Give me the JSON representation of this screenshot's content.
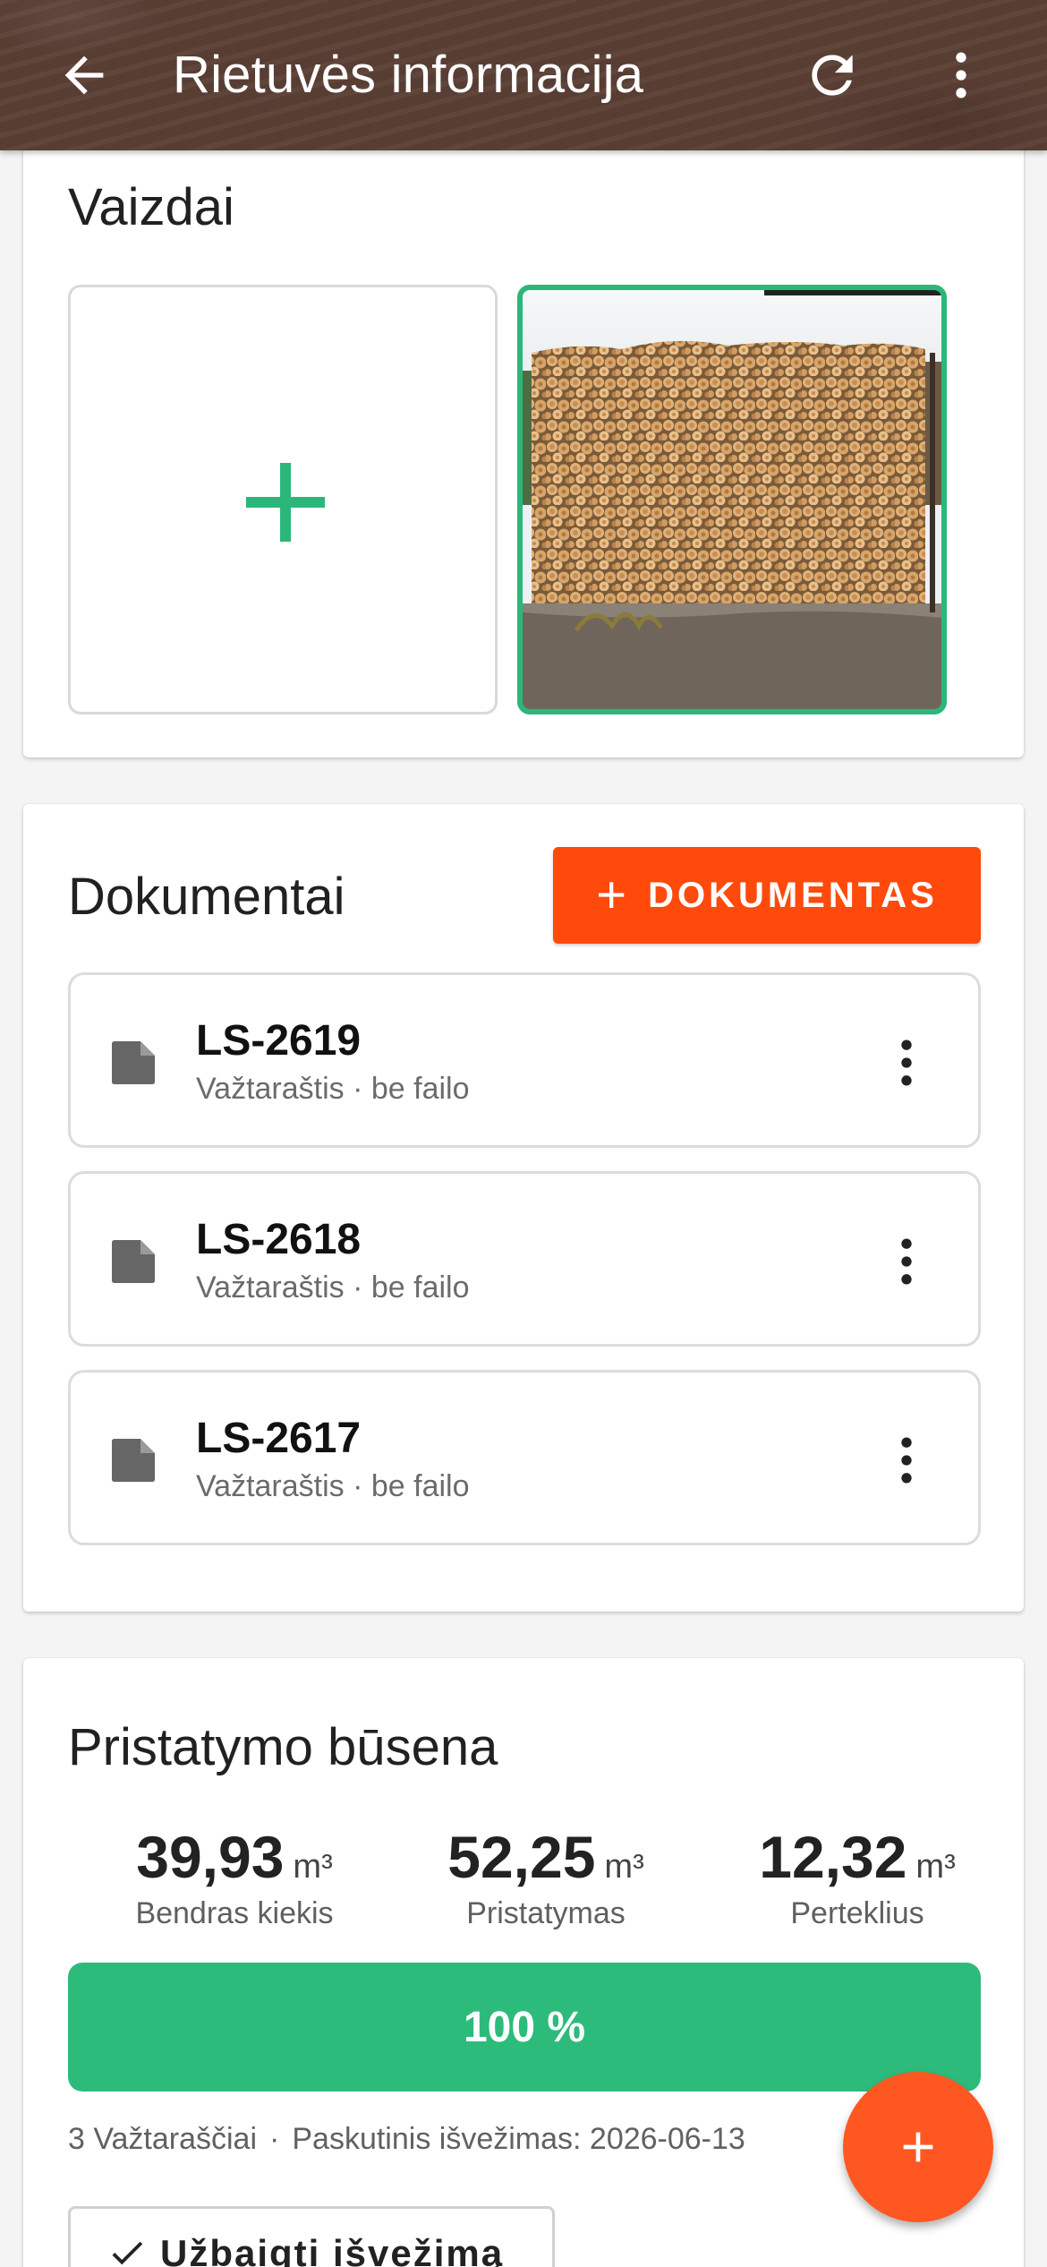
{
  "appbar": {
    "title": "Rietuvės informacija",
    "icons": [
      "arrow-back-icon",
      "refresh-icon",
      "more-vert-icon"
    ]
  },
  "images_section": {
    "title": "Vaizdai",
    "add_icon": "plus-icon",
    "accent_color": "#2cb77a"
  },
  "documents_section": {
    "title": "Dokumentai",
    "add_button_label": "DOKUMENTAS",
    "add_button_icon": "+",
    "button_color": "#ff4a0c",
    "items": [
      {
        "id": "LS-2619",
        "subtitle": "Važtaraštis · be failo"
      },
      {
        "id": "LS-2618",
        "subtitle": "Važtaraštis · be failo"
      },
      {
        "id": "LS-2617",
        "subtitle": "Važtaraštis · be failo"
      }
    ]
  },
  "status_section": {
    "title": "Pristatymo būsena",
    "stats": [
      {
        "value": "39,93",
        "unit": "m³",
        "label": "Bendras kiekis"
      },
      {
        "value": "52,25",
        "unit": "m³",
        "label": "Pristatymas"
      },
      {
        "value": "12,32",
        "unit": "m³",
        "label": "Perteklius"
      }
    ],
    "progress_label": "100 %",
    "progress_fraction": 1.0,
    "progress_color": "#2dbb7c",
    "meta_count": "3 Važtaraščiai",
    "meta_separator": "·",
    "meta_last": "Paskutinis išvežimas: 2026-06-13",
    "finish_button_label": "Užbaigti išvežimą"
  },
  "fab": {
    "icon": "plus-icon",
    "color": "#ff5722"
  }
}
